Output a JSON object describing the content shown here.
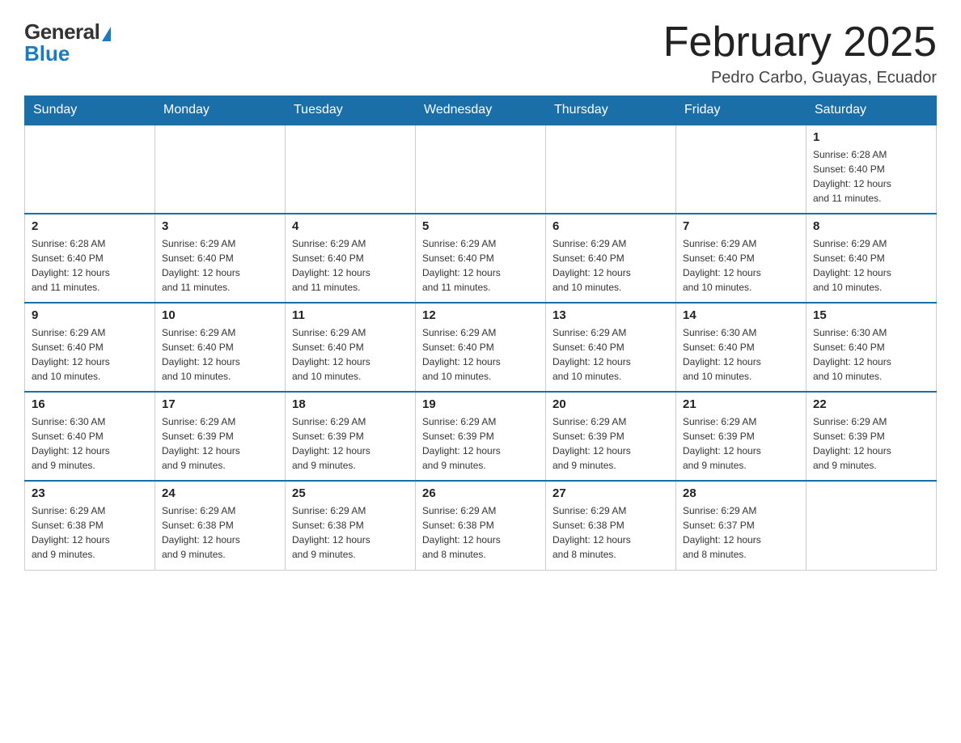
{
  "logo": {
    "general": "General",
    "blue": "Blue"
  },
  "header": {
    "month_year": "February 2025",
    "location": "Pedro Carbo, Guayas, Ecuador"
  },
  "weekdays": [
    "Sunday",
    "Monday",
    "Tuesday",
    "Wednesday",
    "Thursday",
    "Friday",
    "Saturday"
  ],
  "weeks": [
    [
      {
        "day": "",
        "info": ""
      },
      {
        "day": "",
        "info": ""
      },
      {
        "day": "",
        "info": ""
      },
      {
        "day": "",
        "info": ""
      },
      {
        "day": "",
        "info": ""
      },
      {
        "day": "",
        "info": ""
      },
      {
        "day": "1",
        "info": "Sunrise: 6:28 AM\nSunset: 6:40 PM\nDaylight: 12 hours\nand 11 minutes."
      }
    ],
    [
      {
        "day": "2",
        "info": "Sunrise: 6:28 AM\nSunset: 6:40 PM\nDaylight: 12 hours\nand 11 minutes."
      },
      {
        "day": "3",
        "info": "Sunrise: 6:29 AM\nSunset: 6:40 PM\nDaylight: 12 hours\nand 11 minutes."
      },
      {
        "day": "4",
        "info": "Sunrise: 6:29 AM\nSunset: 6:40 PM\nDaylight: 12 hours\nand 11 minutes."
      },
      {
        "day": "5",
        "info": "Sunrise: 6:29 AM\nSunset: 6:40 PM\nDaylight: 12 hours\nand 11 minutes."
      },
      {
        "day": "6",
        "info": "Sunrise: 6:29 AM\nSunset: 6:40 PM\nDaylight: 12 hours\nand 10 minutes."
      },
      {
        "day": "7",
        "info": "Sunrise: 6:29 AM\nSunset: 6:40 PM\nDaylight: 12 hours\nand 10 minutes."
      },
      {
        "day": "8",
        "info": "Sunrise: 6:29 AM\nSunset: 6:40 PM\nDaylight: 12 hours\nand 10 minutes."
      }
    ],
    [
      {
        "day": "9",
        "info": "Sunrise: 6:29 AM\nSunset: 6:40 PM\nDaylight: 12 hours\nand 10 minutes."
      },
      {
        "day": "10",
        "info": "Sunrise: 6:29 AM\nSunset: 6:40 PM\nDaylight: 12 hours\nand 10 minutes."
      },
      {
        "day": "11",
        "info": "Sunrise: 6:29 AM\nSunset: 6:40 PM\nDaylight: 12 hours\nand 10 minutes."
      },
      {
        "day": "12",
        "info": "Sunrise: 6:29 AM\nSunset: 6:40 PM\nDaylight: 12 hours\nand 10 minutes."
      },
      {
        "day": "13",
        "info": "Sunrise: 6:29 AM\nSunset: 6:40 PM\nDaylight: 12 hours\nand 10 minutes."
      },
      {
        "day": "14",
        "info": "Sunrise: 6:30 AM\nSunset: 6:40 PM\nDaylight: 12 hours\nand 10 minutes."
      },
      {
        "day": "15",
        "info": "Sunrise: 6:30 AM\nSunset: 6:40 PM\nDaylight: 12 hours\nand 10 minutes."
      }
    ],
    [
      {
        "day": "16",
        "info": "Sunrise: 6:30 AM\nSunset: 6:40 PM\nDaylight: 12 hours\nand 9 minutes."
      },
      {
        "day": "17",
        "info": "Sunrise: 6:29 AM\nSunset: 6:39 PM\nDaylight: 12 hours\nand 9 minutes."
      },
      {
        "day": "18",
        "info": "Sunrise: 6:29 AM\nSunset: 6:39 PM\nDaylight: 12 hours\nand 9 minutes."
      },
      {
        "day": "19",
        "info": "Sunrise: 6:29 AM\nSunset: 6:39 PM\nDaylight: 12 hours\nand 9 minutes."
      },
      {
        "day": "20",
        "info": "Sunrise: 6:29 AM\nSunset: 6:39 PM\nDaylight: 12 hours\nand 9 minutes."
      },
      {
        "day": "21",
        "info": "Sunrise: 6:29 AM\nSunset: 6:39 PM\nDaylight: 12 hours\nand 9 minutes."
      },
      {
        "day": "22",
        "info": "Sunrise: 6:29 AM\nSunset: 6:39 PM\nDaylight: 12 hours\nand 9 minutes."
      }
    ],
    [
      {
        "day": "23",
        "info": "Sunrise: 6:29 AM\nSunset: 6:38 PM\nDaylight: 12 hours\nand 9 minutes."
      },
      {
        "day": "24",
        "info": "Sunrise: 6:29 AM\nSunset: 6:38 PM\nDaylight: 12 hours\nand 9 minutes."
      },
      {
        "day": "25",
        "info": "Sunrise: 6:29 AM\nSunset: 6:38 PM\nDaylight: 12 hours\nand 9 minutes."
      },
      {
        "day": "26",
        "info": "Sunrise: 6:29 AM\nSunset: 6:38 PM\nDaylight: 12 hours\nand 8 minutes."
      },
      {
        "day": "27",
        "info": "Sunrise: 6:29 AM\nSunset: 6:38 PM\nDaylight: 12 hours\nand 8 minutes."
      },
      {
        "day": "28",
        "info": "Sunrise: 6:29 AM\nSunset: 6:37 PM\nDaylight: 12 hours\nand 8 minutes."
      },
      {
        "day": "",
        "info": ""
      }
    ]
  ],
  "colors": {
    "header_bg": "#1a6fa8",
    "accent": "#1a7bbf"
  }
}
